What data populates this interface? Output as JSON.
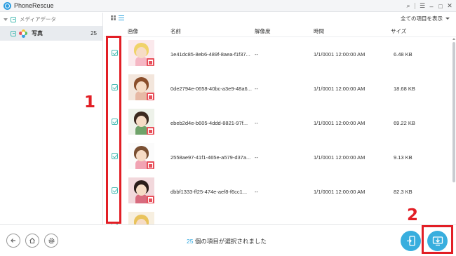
{
  "app": {
    "title": "PhoneRescue"
  },
  "window_controls": {
    "search": "⌕",
    "menu": "☰",
    "minimize": "–",
    "maximize": "□",
    "close": "✕"
  },
  "sidebar": {
    "media_header": "メディアデータ",
    "items": [
      {
        "label": "写真",
        "count": "25",
        "icon": "photos-flower-icon"
      }
    ]
  },
  "toolbar": {
    "filter_label": "全ての項目を表示"
  },
  "table": {
    "columns": [
      "画像",
      "名前",
      "解像度",
      "時間",
      "サイズ"
    ],
    "rows": [
      {
        "name": "1e41dc85-8eb6-489f-8aea-f1f37...",
        "resolution": "--",
        "time": "1/1/0001 12:00:00 AM",
        "size": "6.48 KB",
        "checked": true
      },
      {
        "name": "0de2794e-0658-40bc-a3e9-48a6...",
        "resolution": "--",
        "time": "1/1/0001 12:00:00 AM",
        "size": "18.68 KB",
        "checked": true
      },
      {
        "name": "ebeb2d4e-b605-4ddd-8821-97f...",
        "resolution": "--",
        "time": "1/1/0001 12:00:00 AM",
        "size": "69.22 KB",
        "checked": true
      },
      {
        "name": "2558ae97-41f1-465e-a579-d37a...",
        "resolution": "--",
        "time": "1/1/0001 12:00:00 AM",
        "size": "9.13 KB",
        "checked": true
      },
      {
        "name": "dbbf1333-ff25-474e-aef8-f6cc1...",
        "resolution": "--",
        "time": "1/1/0001 12:00:00 AM",
        "size": "82.3 KB",
        "checked": true
      },
      {
        "name": "",
        "resolution": "",
        "time": "",
        "size": "",
        "checked": true
      }
    ]
  },
  "bottom": {
    "selected_count": "25",
    "status_suffix": " 個の項目が選択されました"
  },
  "annotations": {
    "label_1": "1",
    "label_2": "2"
  },
  "colors": {
    "accent": "#38aede",
    "check": "#4bbcb4",
    "annotation": "#e21e25",
    "delete": "#e8505b"
  }
}
